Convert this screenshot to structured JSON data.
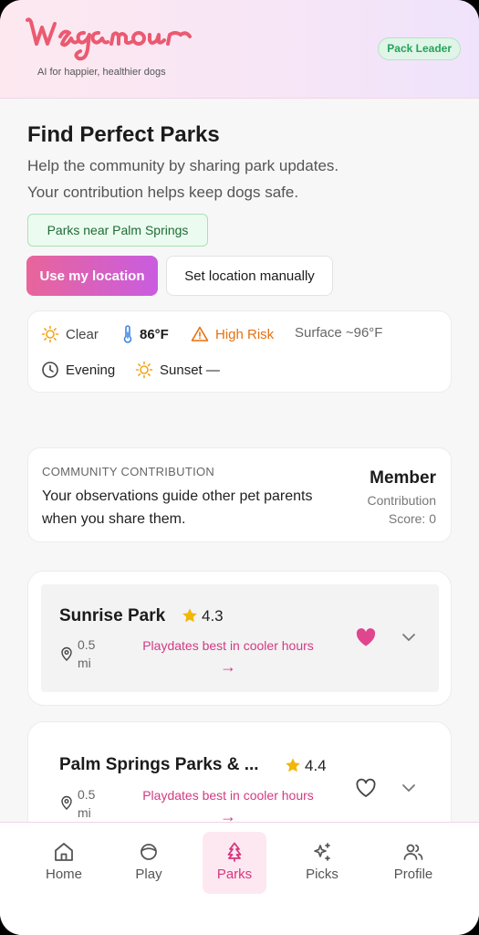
{
  "header": {
    "brand": "wagamour",
    "tagline": "AI for happier, healthier dogs",
    "badge": "Pack Leader"
  },
  "main": {
    "title": "Find Perfect Parks",
    "subtitle_line1": "Help the community by sharing park updates.",
    "subtitle_line2": "Your contribution helps keep dogs safe.",
    "parks_near": "Parks near Palm Springs",
    "use_location_label": "Use my location",
    "set_manual_label": "Set location manually"
  },
  "weather": {
    "condition": "Clear",
    "temperature": "86°F",
    "risk": "High Risk",
    "surface": "Surface ~96°F",
    "time_of_day": "Evening",
    "sunset": "Sunset —",
    "colors": {
      "risk": "#e8700f",
      "sun": "#f2a51f",
      "temp": "#3d86e6"
    }
  },
  "community": {
    "label": "COMMUNITY CONTRIBUTION",
    "text": "Your observations guide other pet parents when you share them.",
    "rank": "Member",
    "score_line1": "Contribution",
    "score_line2": "Score: 0"
  },
  "parks": [
    {
      "name": "Sunrise Park",
      "rating": "4.3",
      "distance_line1": "0.5",
      "distance_line2": "mi",
      "tip": "Playdates best in cooler hours",
      "arrow": "→",
      "favorited": true
    },
    {
      "name": "Palm Springs Parks & ...",
      "rating": "4.4",
      "distance_line1": "0.5",
      "distance_line2": "mi",
      "tip": "Playdates best in cooler hours",
      "arrow": "→",
      "favorited": false
    }
  ],
  "nav": {
    "items": [
      {
        "label": "Home",
        "icon": "home-icon"
      },
      {
        "label": "Play",
        "icon": "ball-icon"
      },
      {
        "label": "Parks",
        "icon": "tree-icon"
      },
      {
        "label": "Picks",
        "icon": "sparkles-icon"
      },
      {
        "label": "Profile",
        "icon": "users-icon"
      }
    ],
    "active": "Parks"
  },
  "colors": {
    "accent": "#d8357f",
    "brand": "#ea5a70",
    "success": "#23a35b",
    "star": "#f2b705"
  }
}
